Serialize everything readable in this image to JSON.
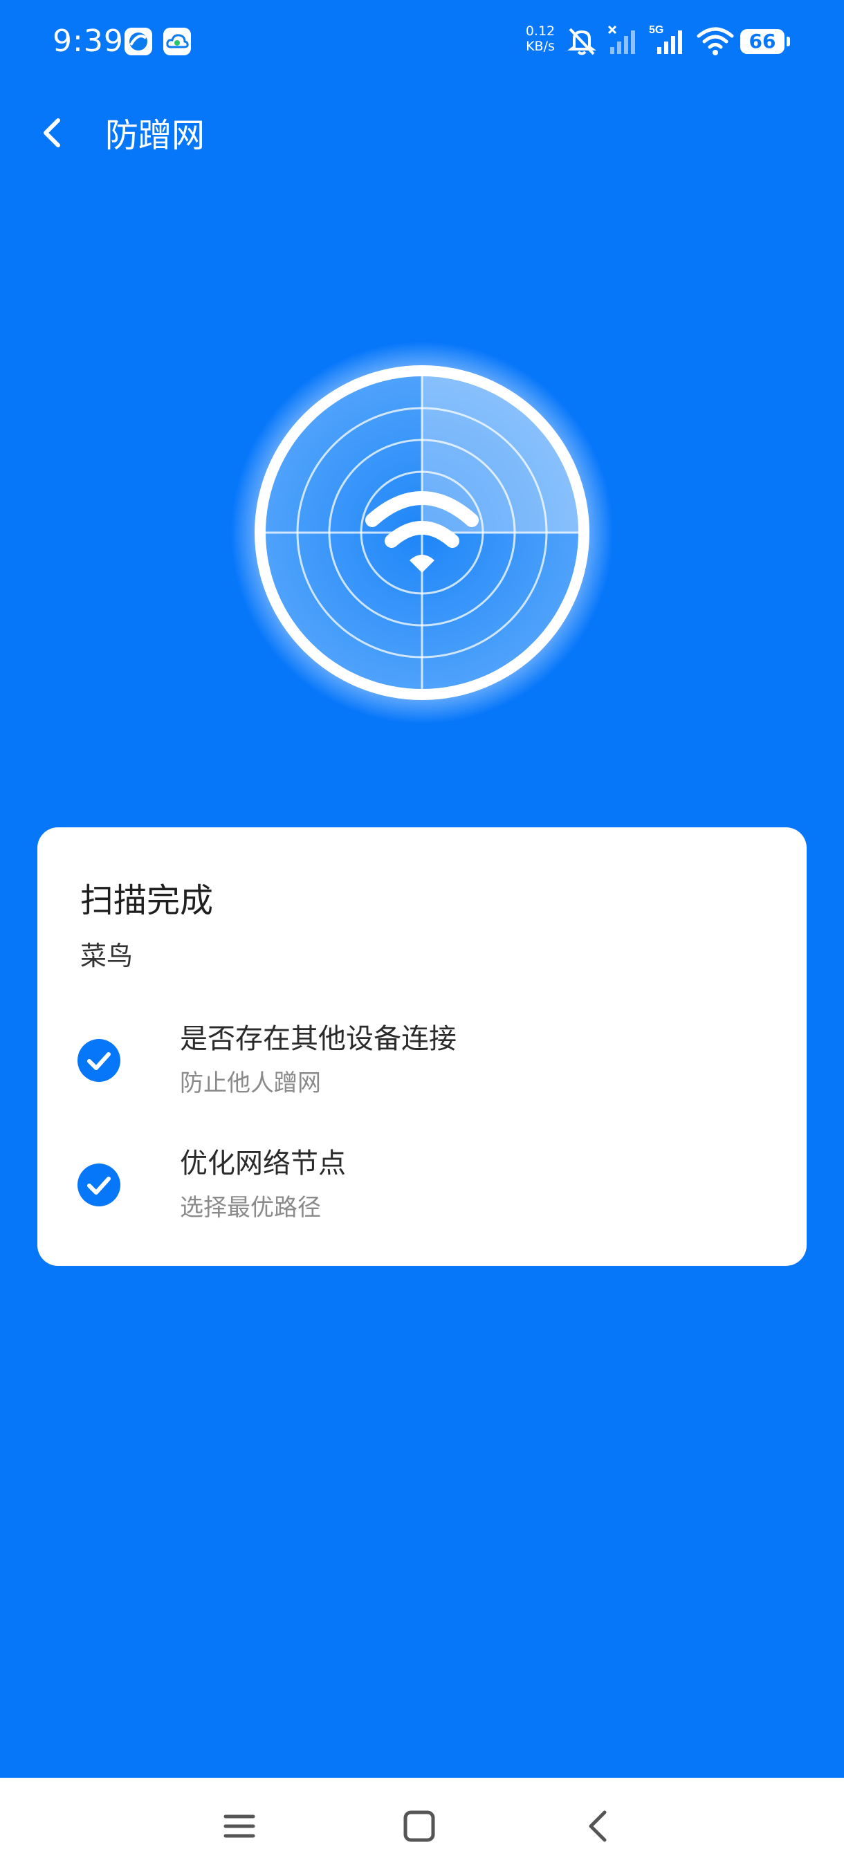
{
  "status_bar": {
    "time": "9:39",
    "net_speed_value": "0.12",
    "net_speed_unit": "KB/s",
    "signal_type": "5G",
    "battery_level": "66"
  },
  "header": {
    "title": "防蹭网",
    "back_icon": "chevron-left-icon"
  },
  "radar": {
    "icon": "wifi-icon"
  },
  "result_card": {
    "title": "扫描完成",
    "network_name": "菜鸟",
    "items": [
      {
        "title": "是否存在其他设备连接",
        "description": "防止他人蹭网",
        "status": "checked"
      },
      {
        "title": "优化网络节点",
        "description": "选择最优路径",
        "status": "checked"
      }
    ]
  },
  "nav_bar": {
    "menu_icon": "menu-icon",
    "home_icon": "home-icon",
    "back_icon": "back-icon"
  },
  "colors": {
    "background": "#0777FA",
    "card": "#FFFFFF",
    "check": "#0777FA"
  }
}
